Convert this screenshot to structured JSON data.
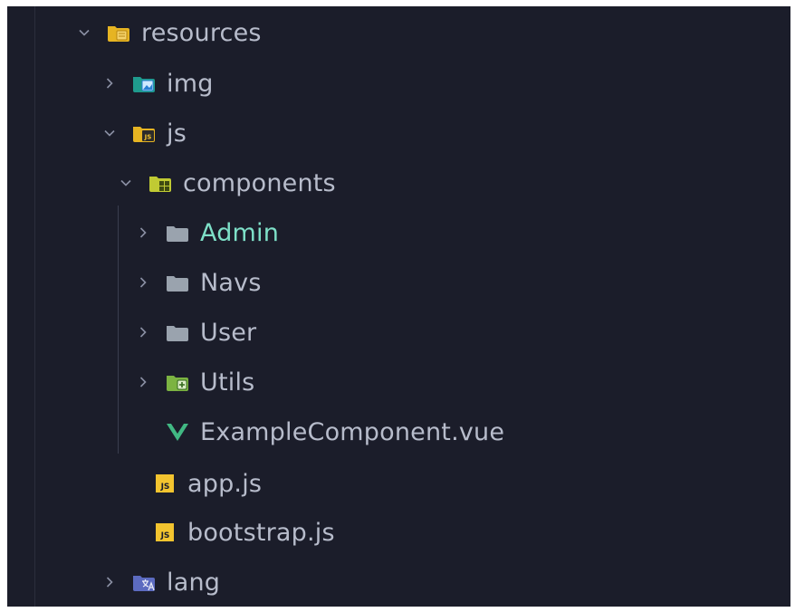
{
  "explorer": {
    "items": [
      {
        "label": "resources",
        "kind": "folder",
        "icon": "folder-resources-icon",
        "expanded": true,
        "depth": 0
      },
      {
        "label": "img",
        "kind": "folder",
        "icon": "folder-images-icon",
        "expanded": false,
        "depth": 1
      },
      {
        "label": "js",
        "kind": "folder",
        "icon": "folder-js-icon",
        "expanded": true,
        "depth": 1
      },
      {
        "label": "components",
        "kind": "folder",
        "icon": "folder-components-icon",
        "expanded": true,
        "depth": 2
      },
      {
        "label": "Admin",
        "kind": "folder",
        "icon": "folder-gray-icon",
        "expanded": false,
        "depth": 3,
        "active": true
      },
      {
        "label": "Navs",
        "kind": "folder",
        "icon": "folder-gray-icon",
        "expanded": false,
        "depth": 3
      },
      {
        "label": "User",
        "kind": "folder",
        "icon": "folder-gray-icon",
        "expanded": false,
        "depth": 3
      },
      {
        "label": "Utils",
        "kind": "folder",
        "icon": "folder-utils-icon",
        "expanded": false,
        "depth": 3
      },
      {
        "label": "ExampleComponent.vue",
        "kind": "file",
        "icon": "vue-file-icon",
        "depth": 3
      },
      {
        "label": "app.js",
        "kind": "file",
        "icon": "js-file-icon",
        "depth": 2
      },
      {
        "label": "bootstrap.js",
        "kind": "file",
        "icon": "js-file-icon",
        "depth": 2
      },
      {
        "label": "lang",
        "kind": "folder",
        "icon": "folder-lang-icon",
        "expanded": false,
        "depth": 1
      }
    ]
  },
  "colors": {
    "background": "#1b1d2a",
    "text": "#b7bccb",
    "active_text": "#7ee0c8",
    "chevron": "#8a8fa3",
    "folder_gray": "#9aa3ae",
    "folder_yellow": "#e6b422",
    "folder_teal": "#1f9b8d",
    "folder_green": "#7cb342",
    "folder_lang": "#5c6bc0",
    "vue_green": "#41b883",
    "js_yellow": "#f3c42f"
  }
}
